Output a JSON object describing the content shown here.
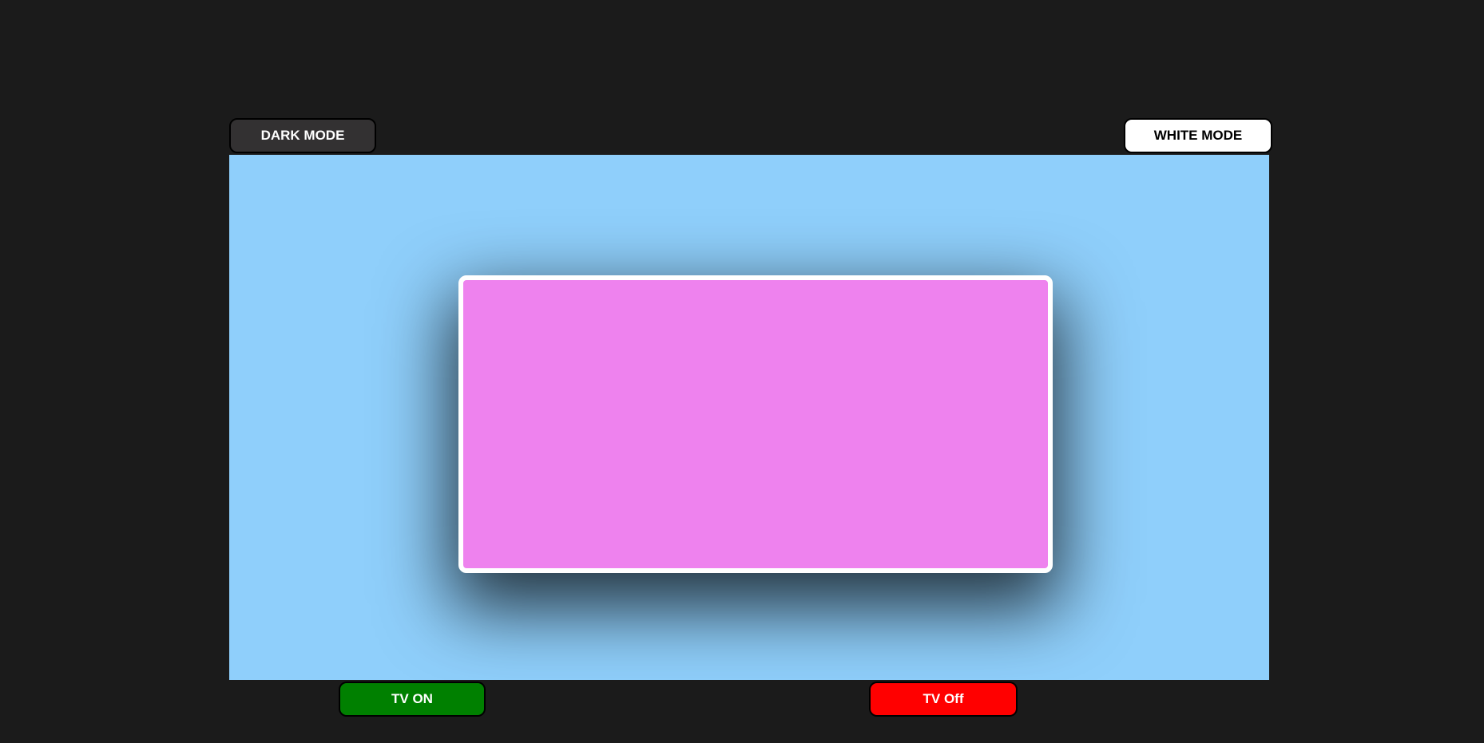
{
  "controls": {
    "dark_mode_label": "DARK MODE",
    "white_mode_label": "WHITE MODE",
    "tv_on_label": "TV ON",
    "tv_off_label": "TV Off"
  },
  "colors": {
    "page_background": "#1b1b1b",
    "stage_background": "#8fcffb",
    "tv_screen": "#ee82ee",
    "tv_frame": "#ffffff",
    "dark_mode_button": "#333132",
    "white_mode_button": "#ffffff",
    "tv_on_button": "#008000",
    "tv_off_button": "#ff0000"
  }
}
